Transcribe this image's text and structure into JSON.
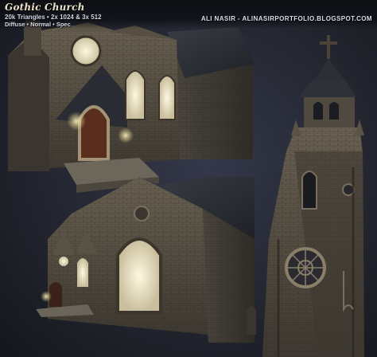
{
  "header": {
    "title": "Gothic Church",
    "subtitle": "20k Triangles • 2x 1024 & 3x 512",
    "maps": "Diffuse • Normal • Spec",
    "credit": "ALI NASIR - ALINASIRPORTFOLIO.BLOGSPOT.COM"
  },
  "colors": {
    "background": "#1c1f2a",
    "stone": "#5a5245",
    "roof": "#2b2e36",
    "window_glow": "#f3ecd2",
    "lamp_glow": "#e8d88a"
  }
}
